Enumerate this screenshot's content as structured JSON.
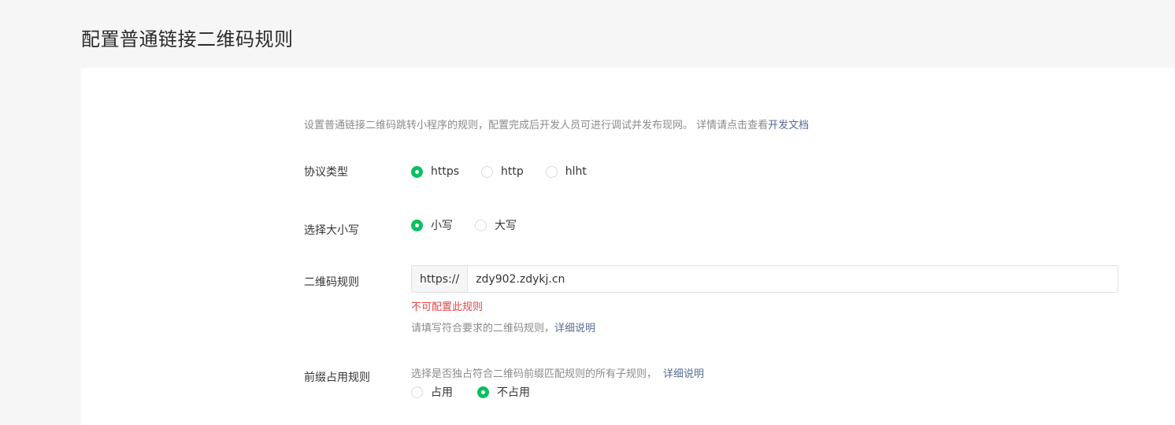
{
  "page": {
    "title": "配置普通链接二维码规则"
  },
  "intro": {
    "text": "设置普通链接二维码跳转小程序的规则，配置完成后开发人员可进行调试并发布现网。 详情请点击查看",
    "link": "开发文档"
  },
  "protocol": {
    "label": "协议类型",
    "options": [
      {
        "label": "https",
        "checked": true
      },
      {
        "label": "http",
        "checked": false
      },
      {
        "label": "hlht",
        "checked": false
      }
    ]
  },
  "case": {
    "label": "选择大小写",
    "options": [
      {
        "label": "小写",
        "checked": true
      },
      {
        "label": "大写",
        "checked": false
      }
    ]
  },
  "qr_rule": {
    "label": "二维码规则",
    "prefix": "https://",
    "value": "zdy902.zdykj.cn",
    "error": "不可配置此规则",
    "tip": "请填写符合要求的二维码规则，",
    "tip_link": "详细说明"
  },
  "prefix_rule": {
    "label": "前缀占用规则",
    "tip": "选择是否独占符合二维码前缀匹配规则的所有子规则，",
    "tip_link": "详细说明",
    "options": [
      {
        "label": "占用",
        "checked": false
      },
      {
        "label": "不占用",
        "checked": true
      }
    ]
  },
  "colors": {
    "accent": "#07c160",
    "link": "#576b95",
    "error": "#e54545"
  }
}
